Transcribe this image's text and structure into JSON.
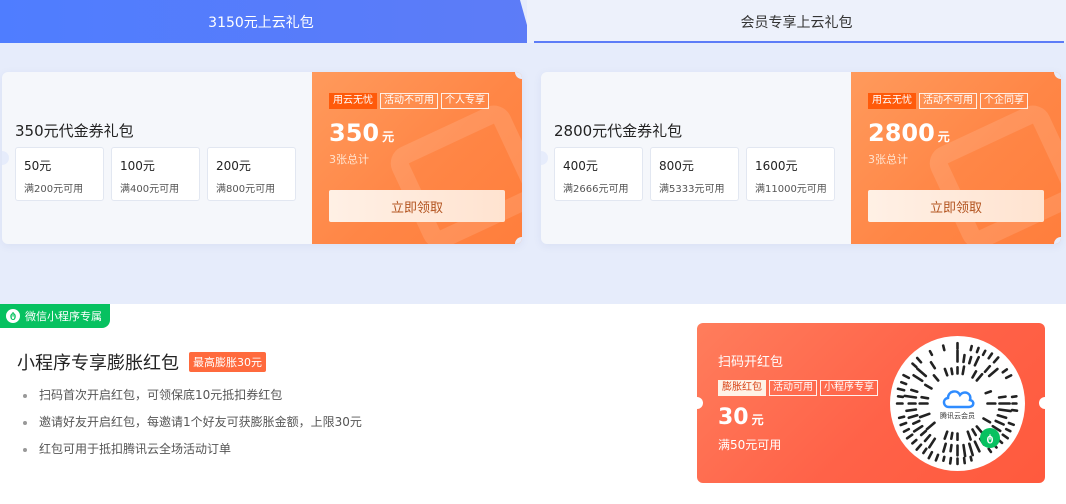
{
  "tabs": [
    {
      "label": "3150元上云礼包"
    },
    {
      "label": "会员专享上云礼包"
    }
  ],
  "coupons": [
    {
      "title": "350元代金券礼包",
      "vouchers": [
        {
          "amount": "50元",
          "condition": "满200元可用"
        },
        {
          "amount": "100元",
          "condition": "满400元可用"
        },
        {
          "amount": "200元",
          "condition": "满800元可用"
        }
      ],
      "tags": [
        "用云无忧",
        "活动不可用",
        "个人专享"
      ],
      "price": "350",
      "unit": "元",
      "count": "3张总计",
      "button": "立即领取"
    },
    {
      "title": "2800元代金券礼包",
      "vouchers": [
        {
          "amount": "400元",
          "condition": "满2666元可用"
        },
        {
          "amount": "800元",
          "condition": "满5333元可用"
        },
        {
          "amount": "1600元",
          "condition": "满11000元可用"
        }
      ],
      "tags": [
        "用云无忧",
        "活动不可用",
        "个企同享"
      ],
      "price": "2800",
      "unit": "元",
      "count": "3张总计",
      "button": "立即领取"
    }
  ],
  "mini": {
    "badge": "微信小程序专属",
    "title": "小程序专享膨胀红包",
    "max_badge": "最高膨胀30元",
    "bullets": [
      "扫码首次开启红包，可领保底10元抵扣券红包",
      "邀请好友开启红包，每邀请1个好友可获膨胀金额，上限30元",
      "红包可用于抵扣腾讯云全场活动订单"
    ],
    "packet": {
      "title": "扫码开红包",
      "tags": [
        "膨胀红包",
        "活动可用",
        "小程序专享"
      ],
      "price": "30",
      "unit": "元",
      "condition": "满50元可用",
      "qr_logo_text": "腾讯云会员"
    }
  },
  "colors": {
    "active_tab": "#5d7cf7",
    "coupon_orange": "#ff8646",
    "wechat_green": "#07c160",
    "red_packet": "#ff6248"
  }
}
